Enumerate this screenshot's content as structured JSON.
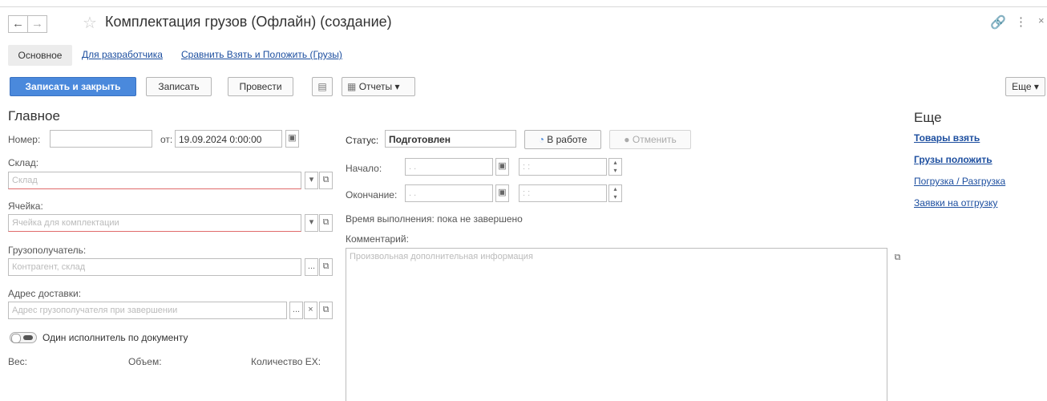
{
  "title": "Комплектация грузов (Офлайн) (создание)",
  "tabs": {
    "main": "Основное",
    "developer": "Для разработчика",
    "compare": "Сравнить Взять и Положить (Грузы)"
  },
  "toolbar": {
    "save_close": "Записать и закрыть",
    "save": "Записать",
    "post": "Провести",
    "reports": "Отчеты",
    "more": "Еще"
  },
  "form": {
    "section_title": "Главное",
    "number_label": "Номер:",
    "number_value": "",
    "from_label": "от:",
    "date_value": "19.09.2024  0:00:00",
    "warehouse_label": "Склад:",
    "warehouse_placeholder": "Склад",
    "cell_label": "Ячейка:",
    "cell_placeholder": "Ячейка для комплектации",
    "consignee_label": "Грузополучатель:",
    "consignee_placeholder": "Контрагент, склад",
    "address_label": "Адрес доставки:",
    "address_placeholder": "Адрес грузополучателя при завершении",
    "toggle_label": "Один исполнитель по документу",
    "weight_label": "Вес:",
    "volume_label": "Объем:",
    "quantity_label": "Количество ЕХ:"
  },
  "status": {
    "label": "Статус:",
    "value": "Подготовлен",
    "in_work_button": "В работе",
    "cancel_button": "Отменить",
    "start_label": "Начало:",
    "end_label": "Окончание:",
    "date_placeholder": ". .",
    "time_placeholder": ": :",
    "duration_text": "Время выполнения: пока не завершено",
    "comment_label": "Комментарий:",
    "comment_placeholder": "Произвольная дополнительная информация"
  },
  "sidebar": {
    "title": "Еще",
    "items": [
      {
        "label": "Товары взять",
        "bold": true
      },
      {
        "label": "Грузы положить",
        "bold": true
      },
      {
        "label": "Погрузка / Разгрузка",
        "bold": false
      },
      {
        "label": "Заявки на отгрузку",
        "bold": false
      }
    ]
  },
  "colors": {
    "primary_button": "#4a89dc",
    "link": "#1c4e9f",
    "required_underline": "#e06b6b"
  }
}
